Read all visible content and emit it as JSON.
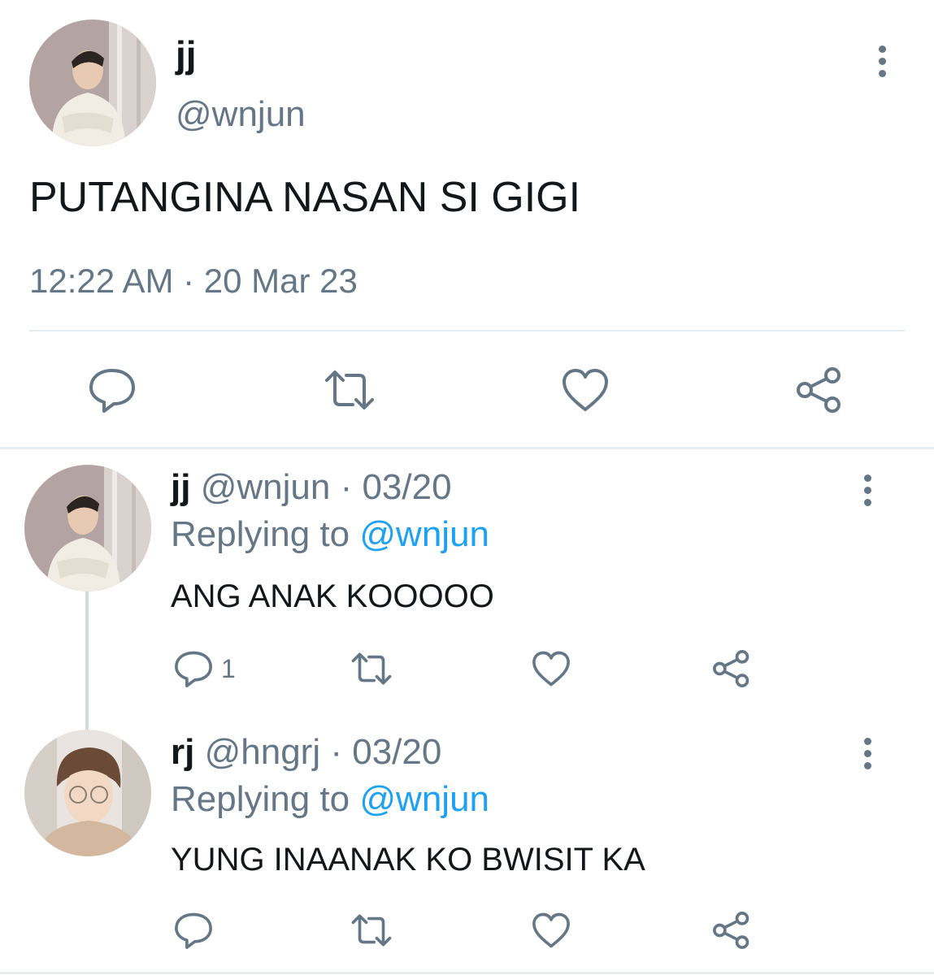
{
  "main_tweet": {
    "display_name": "jj",
    "handle": "@wnjun",
    "text": "PUTANGINA NASAN SI GIGI",
    "timestamp": "12:22 AM · 20 Mar 23"
  },
  "replies": [
    {
      "display_name": "jj",
      "handle": "@wnjun",
      "date": "· 03/20",
      "replying_prefix": "Replying to",
      "replying_to": "@wnjun",
      "text": "ANG ANAK KOOOOO",
      "reply_count": "1"
    },
    {
      "display_name": "rj",
      "handle": "@hngrj",
      "date": "· 03/20",
      "replying_prefix": "Replying to",
      "replying_to": "@wnjun",
      "text": "YUNG INAANAK KO BWISIT KA",
      "reply_count": ""
    }
  ],
  "icons": {
    "more": "more-vertical-icon",
    "reply": "speech-bubble-icon",
    "retweet": "retweet-icon",
    "like": "heart-icon",
    "share": "share-icon"
  },
  "colors": {
    "text": "#14171a",
    "muted": "#657786",
    "link": "#1da1f2",
    "divider": "#e6ecf0"
  }
}
